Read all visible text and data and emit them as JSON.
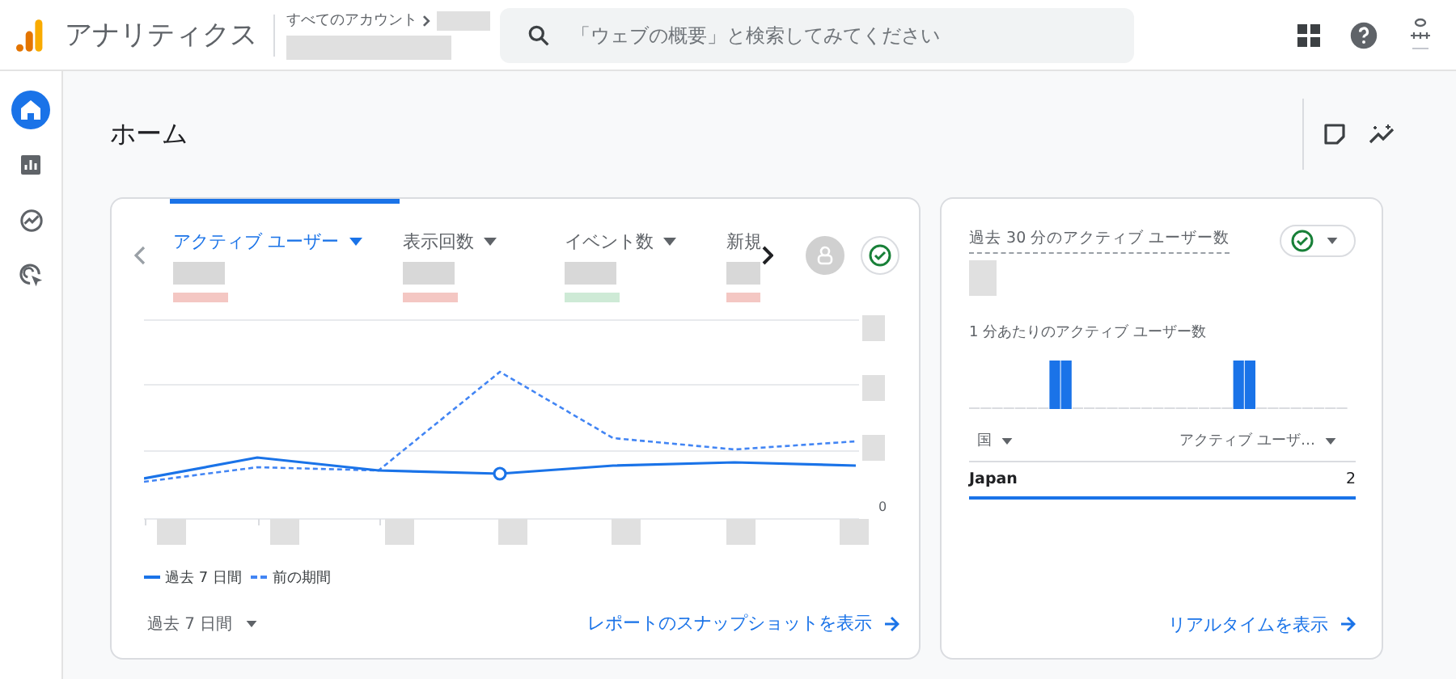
{
  "header": {
    "product": "アナリティクス",
    "breadcrumb": "すべてのアカウント",
    "search": {
      "placeholder": "「ウェブの概要」と検索してみてください"
    }
  },
  "sidebar": {
    "items": [
      {
        "kind": "home",
        "selected": true
      },
      {
        "kind": "reports",
        "selected": false
      },
      {
        "kind": "explore",
        "selected": false
      },
      {
        "kind": "advertising",
        "selected": false
      }
    ]
  },
  "page": {
    "title": "ホーム"
  },
  "overview": {
    "metrics": [
      {
        "label": "アクティブ ユーザー",
        "selected": true,
        "dropdown": true
      },
      {
        "label": "表示回数",
        "selected": false,
        "dropdown": true
      },
      {
        "label": "イベント数",
        "selected": false,
        "dropdown": true
      },
      {
        "label": "新規",
        "selected": false,
        "dropdown": false
      }
    ],
    "y_axis_label": "0",
    "legend": [
      {
        "label": "過去 7 日間",
        "kind": "solid"
      },
      {
        "label": "前の期間",
        "kind": "dashed"
      }
    ],
    "date_range": "過去 7 日間",
    "link": "レポートのスナップショットを表示"
  },
  "realtime": {
    "title": "過去 30 分のアクティブ ユーザー数",
    "subtitle": "1 分あたりのアクティブ ユーザー数",
    "columns": [
      "国",
      "アクティブ ユーザ…"
    ],
    "rows": [
      {
        "country": "Japan",
        "value": "2"
      }
    ],
    "link": "リアルタイムを表示"
  }
}
